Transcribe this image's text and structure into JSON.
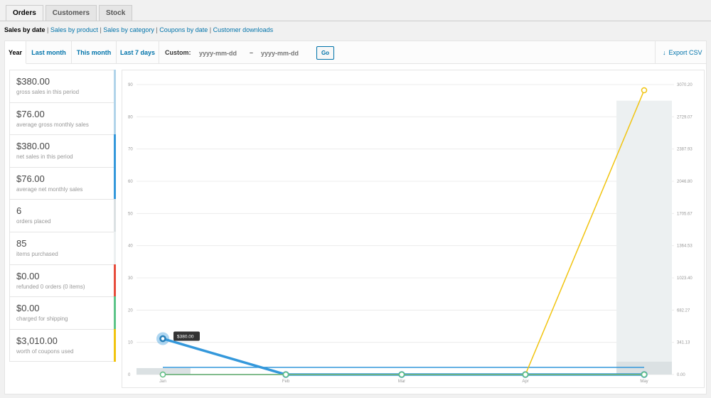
{
  "tabs": [
    {
      "label": "Orders",
      "active": true
    },
    {
      "label": "Customers",
      "active": false
    },
    {
      "label": "Stock",
      "active": false
    }
  ],
  "subnav": {
    "current": "Sales by date",
    "links": [
      "Sales by product",
      "Sales by category",
      "Coupons by date",
      "Customer downloads"
    ]
  },
  "ranges": [
    {
      "label": "Year",
      "active": true
    },
    {
      "label": "Last month",
      "active": false
    },
    {
      "label": "This month",
      "active": false
    },
    {
      "label": "Last 7 days",
      "active": false
    }
  ],
  "custom": {
    "label": "Custom:",
    "start_placeholder": "yyyy-mm-dd",
    "end_placeholder": "yyyy-mm-dd",
    "dash": "–",
    "go_label": "Go"
  },
  "export_label": "Export CSV",
  "legend": [
    {
      "value": "$380.00",
      "desc": "gross sales in this period",
      "color": "#b1d4ea"
    },
    {
      "value": "$76.00",
      "desc": "average gross monthly sales",
      "color": "#b1d4ea"
    },
    {
      "value": "$380.00",
      "desc": "net sales in this period",
      "color": "#3498db"
    },
    {
      "value": "$76.00",
      "desc": "average net monthly sales",
      "color": "#3498db"
    },
    {
      "value": "6",
      "desc": "orders placed",
      "color": "#dbe1e3"
    },
    {
      "value": "85",
      "desc": "items purchased",
      "color": "#ecf0f1"
    },
    {
      "value": "$0.00",
      "desc": "refunded 0 orders (0 items)",
      "color": "#e74c3c"
    },
    {
      "value": "$0.00",
      "desc": "charged for shipping",
      "color": "#5cc488"
    },
    {
      "value": "$3,010.00",
      "desc": "worth of coupons used",
      "color": "#f1c40f"
    }
  ],
  "chart_data": {
    "type": "line",
    "categories": [
      "Jan",
      "Feb",
      "Mar",
      "Apr",
      "May"
    ],
    "y_left": {
      "ticks": [
        "0",
        "10",
        "20",
        "30",
        "40",
        "50",
        "60",
        "70",
        "80",
        "90"
      ],
      "range": [
        0,
        90
      ]
    },
    "y_right": {
      "ticks": [
        "0.00",
        "341.13",
        "682.27",
        "1023.40",
        "1364.53",
        "1705.67",
        "2046.80",
        "2387.93",
        "2729.07",
        "3070.20"
      ],
      "range": [
        0,
        3070.2
      ]
    },
    "bars": [
      {
        "name": "items purchased",
        "color": "#ecf0f1",
        "axis": "left",
        "values": [
          0,
          0,
          0,
          0,
          85
        ]
      },
      {
        "name": "orders placed",
        "color": "#dbe1e3",
        "axis": "left",
        "values": [
          2,
          0,
          0,
          0,
          4
        ]
      }
    ],
    "series": [
      {
        "name": "gross sales",
        "color": "#b1d4ea",
        "axis": "right",
        "values": [
          380,
          0,
          0,
          0,
          0
        ]
      },
      {
        "name": "net sales",
        "color": "#3498db",
        "axis": "right",
        "values": [
          380,
          0,
          0,
          0,
          0
        ]
      },
      {
        "name": "average net monthly sales",
        "color": "#3498db",
        "axis": "right",
        "values": [
          76,
          76,
          76,
          76,
          76
        ]
      },
      {
        "name": "refunded",
        "color": "#e74c3c",
        "axis": "right",
        "values": [
          0,
          0,
          0,
          0,
          0
        ]
      },
      {
        "name": "coupons used",
        "color": "#f1c40f",
        "axis": "right",
        "values": [
          null,
          null,
          null,
          0,
          3010
        ]
      },
      {
        "name": "shipping",
        "color": "#5cc488",
        "axis": "right",
        "values": [
          0,
          0,
          0,
          0,
          0
        ]
      }
    ],
    "tooltip": {
      "label": "$380.00",
      "category": "Jan"
    },
    "grid": true
  }
}
